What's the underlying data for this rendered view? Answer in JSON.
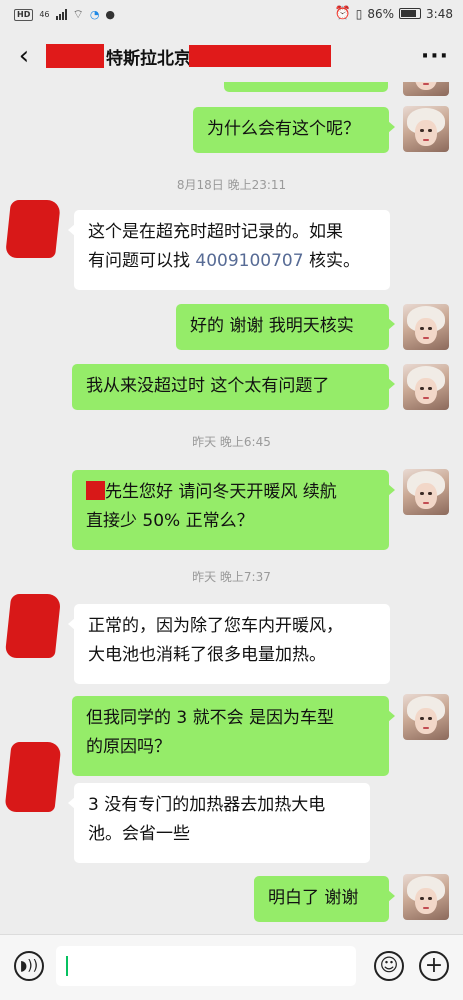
{
  "status_bar": {
    "network": "HD",
    "signal": "46",
    "battery": "86%",
    "time": "3:48"
  },
  "header": {
    "title": "特斯拉北京"
  },
  "messages": [
    {
      "type": "text",
      "side": "me",
      "text": "为什么会有这个呢？"
    },
    {
      "type": "time",
      "text": "8月18日 晚上23:11"
    },
    {
      "type": "text",
      "side": "other",
      "line1": "这个是在超充时超时记录的。如果",
      "line2_prefix": "有问题可以找 ",
      "phone": "4009100707",
      "line2_suffix": " 核实。"
    },
    {
      "type": "text",
      "side": "me",
      "text": "好的 谢谢 我明天核实"
    },
    {
      "type": "text",
      "side": "me",
      "text": "我从来没超过时 这个太有问题了"
    },
    {
      "type": "time",
      "text": "昨天 晚上6:45"
    },
    {
      "type": "text",
      "side": "me",
      "line1": "先生您好 请问冬天开暖风 续航",
      "line2": "直接少 50% 正常么？"
    },
    {
      "type": "time",
      "text": "昨天 晚上7:37"
    },
    {
      "type": "text",
      "side": "other",
      "line1": "正常的，因为除了您车内开暖风，",
      "line2": "大电池也消耗了很多电量加热。"
    },
    {
      "type": "text",
      "side": "me",
      "line1": "但我同学的 3 就不会  是因为车型",
      "line2": "的原因吗？"
    },
    {
      "type": "text",
      "side": "other",
      "line1": "3 没有专门的加热器去加热大电",
      "line2": "池。会省一些"
    },
    {
      "type": "text",
      "side": "me",
      "text": "明白了  谢谢"
    }
  ],
  "icons": {
    "back": "back-arrow-icon",
    "more": "more-icon",
    "voice": "voice-icon",
    "emoji": "emoji-icon",
    "add": "add-icon"
  },
  "colors": {
    "my_bubble": "#95ec69",
    "other_bubble": "#ffffff",
    "background": "#ededed",
    "link": "#576b95",
    "redaction": "#d81818"
  }
}
